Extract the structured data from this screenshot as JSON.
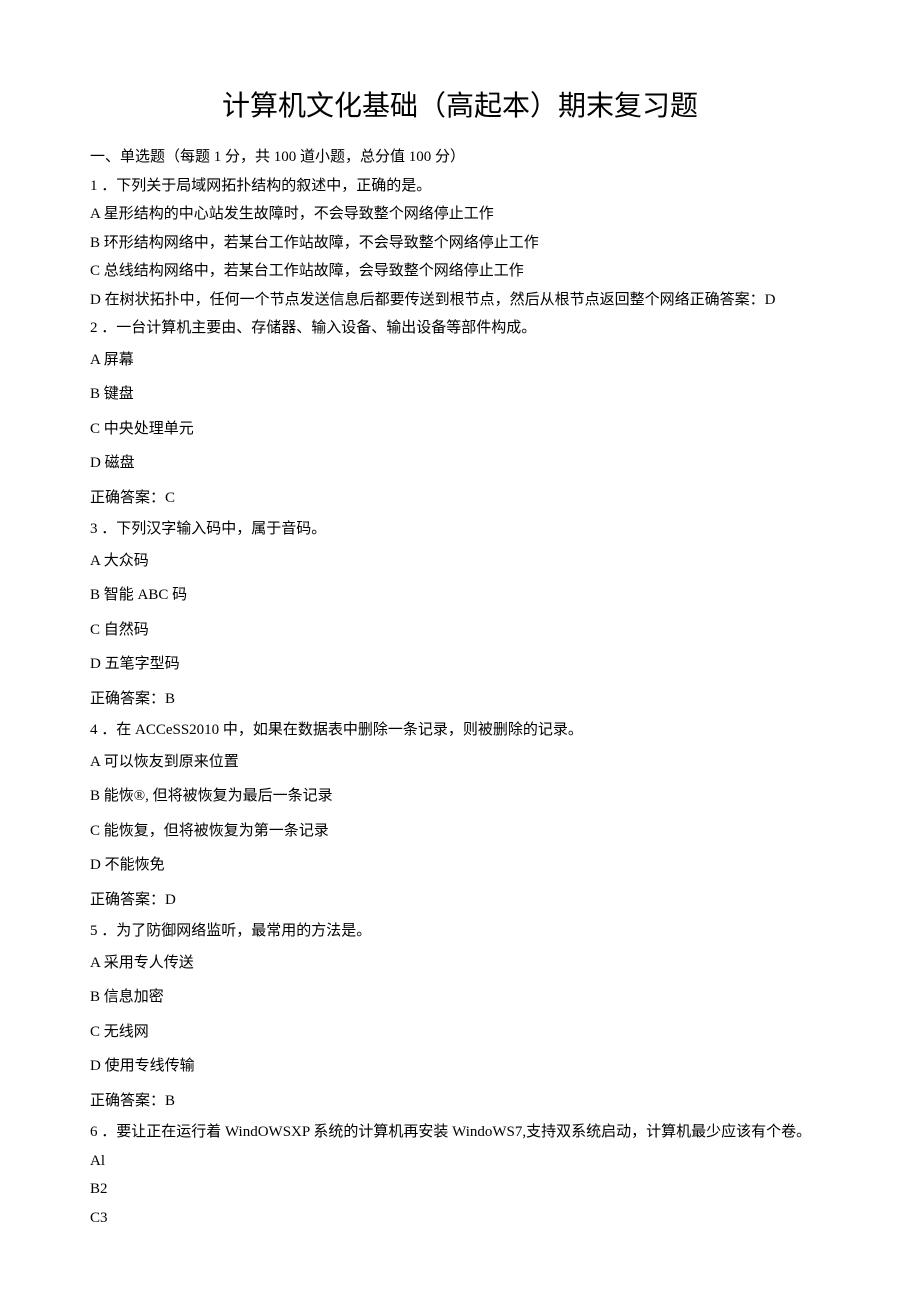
{
  "title": "计算机文化基础（高起本）期末复习题",
  "section_header": "一、单选题（每题 1 分，共 100 道小题，总分值 100 分）",
  "q1": {
    "stem": "1 ．下列关于局域网拓扑结构的叙述中，正确的是。",
    "A": "A 星形结构的中心站发生故障时，不会导致整个网络停止工作",
    "B": "B 环形结构网络中，若某台工作站故障，不会导致整个网络停止工作",
    "C": "C 总线结构网络中，若某台工作站故障，会导致整个网络停止工作",
    "D": "D 在树状拓扑中，任何一个节点发送信息后都要传送到根节点，然后从根节点返回整个网络正确答案：D"
  },
  "q2": {
    "stem": "2 ．一台计算机主要由、存储器、输入设备、输出设备等部件构成。",
    "A": "A 屏幕",
    "B": "B 键盘",
    "C": "C 中央处理单元",
    "D": "D 磁盘",
    "ans": "正确答案：C"
  },
  "q3": {
    "stem": "3 ．下列汉字输入码中，属于音码。",
    "A": "A 大众码",
    "B": "B 智能 ABC 码",
    "C": "C 自然码",
    "D": "D 五笔字型码",
    "ans": "正确答案：B"
  },
  "q4": {
    "stem": "4 ．在 ACCeSS2010 中，如果在数据表中删除一条记录，则被删除的记录。",
    "A": "A 可以恢友到原来位置",
    "B": "B 能恢®, 但将被恢复为最后一条记录",
    "C": "C 能恢复，但将被恢复为第一条记录",
    "D": "D 不能恢免",
    "ans": "正确答案：D"
  },
  "q5": {
    "stem": "5 ．为了防御网络监听，最常用的方法是。",
    "A": "A 采用专人传送",
    "B": "B 信息加密",
    "C": "C 无线网",
    "D": "D 使用专线传输",
    "ans": "正确答案：B"
  },
  "q6": {
    "stem": "6 ．要让正在运行着 WindOWSXP 系统的计算机再安装 WindoWS7,支持双系统启动，计算机最少应该有个卷。",
    "A": "Al",
    "B": "B2",
    "C": "C3"
  }
}
